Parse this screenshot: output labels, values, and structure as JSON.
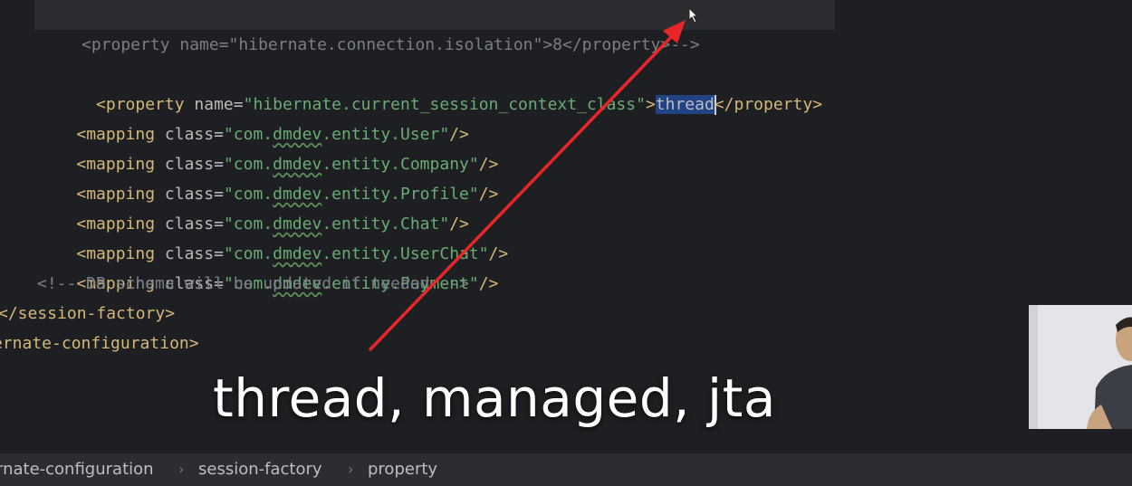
{
  "code": {
    "line1": {
      "tag_open": "<property",
      "attr": "name",
      "eq": "=",
      "value": "\"hibernate.current_session_context_class\"",
      "close": ">",
      "selected": "thread",
      "end_tag": "</property>"
    },
    "line2": "<property name=\"hibernate.connection.isolation\">8</property>-->",
    "mappings": [
      {
        "prefix": "\"com.",
        "pkg": "dmdev",
        "suffix": ".entity.User\""
      },
      {
        "prefix": "\"com.",
        "pkg": "dmdev",
        "suffix": ".entity.Company\""
      },
      {
        "prefix": "\"com.",
        "pkg": "dmdev",
        "suffix": ".entity.Profile\""
      },
      {
        "prefix": "\"com.",
        "pkg": "dmdev",
        "suffix": ".entity.Chat\""
      },
      {
        "prefix": "\"com.",
        "pkg": "dmdev",
        "suffix": ".entity.UserChat\""
      },
      {
        "prefix": "\"com.",
        "pkg": "dmdev",
        "suffix": ".entity.Payment\""
      }
    ],
    "mapping_tag": "<mapping",
    "mapping_attr": "class",
    "mapping_eq": "=",
    "mapping_close": "/>",
    "comment": "<!-- DB schema will be updated if needed -->",
    "session_factory_close": "</session-factory>",
    "config_close": "ernate-configuration>"
  },
  "subtitle": "thread, managed, jta",
  "breadcrumb": {
    "items": [
      "rnate-configuration",
      "session-factory",
      "property"
    ],
    "separator": "›"
  },
  "colors": {
    "background": "#1e1f22",
    "tag": "#d5b778",
    "string": "#6aab73",
    "comment": "#7a7e85",
    "selection": "#214283",
    "arrow": "#e8262a"
  },
  "icons": {
    "arrow": "red-annotation-arrow",
    "webcam": "presenter-webcam"
  }
}
